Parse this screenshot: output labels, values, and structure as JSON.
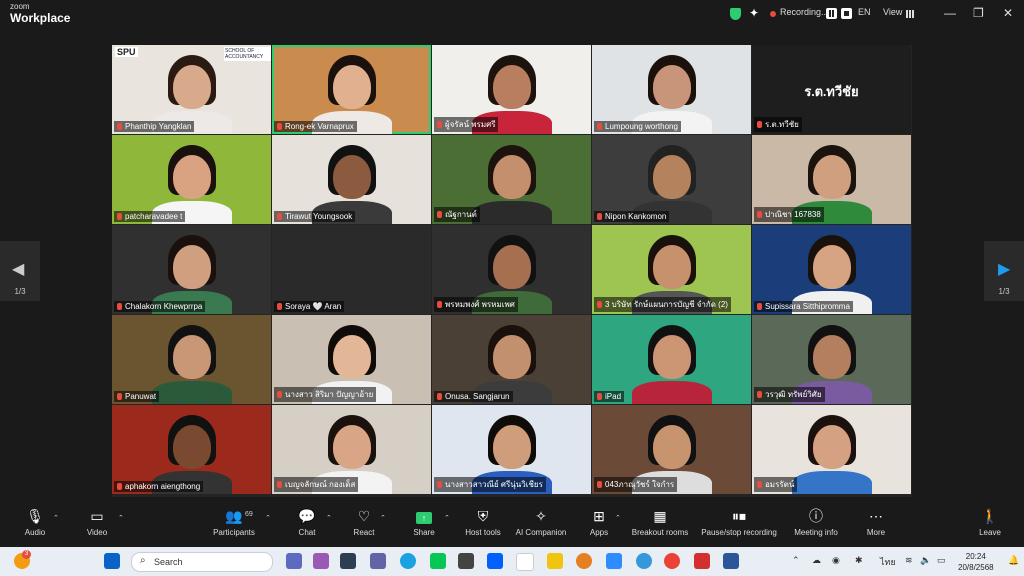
{
  "app": {
    "brand_small": "zoom",
    "brand_large": "Workplace"
  },
  "titlebar": {
    "recording": "Recording...",
    "language": "EN",
    "view": "View"
  },
  "page": {
    "left": "1/3",
    "right": "1/3"
  },
  "participants": [
    {
      "name": "Phanthip Yangklan",
      "logo": "SPU",
      "logo2": "SCHOOL OF ACCOUNTANCY",
      "bg": "#e9e4de",
      "face": "#d8a98a",
      "hair": "#2a1a12",
      "shirt": "#ece9e7"
    },
    {
      "name": "Rong-ek Varnaprux",
      "bg": "#c98b4e",
      "face": "#e0b08f",
      "hair": "#1a110c",
      "shirt": "#efe9e6",
      "active": true
    },
    {
      "name": "ผู้จรัลน์ พรมศรี",
      "bg": "#f0efec",
      "face": "#b97d5f",
      "hair": "#1d130e",
      "shirt": "#c8253a"
    },
    {
      "name": "Lumpoung worthong",
      "bg": "#dfe3e6",
      "face": "#c9957a",
      "hair": "#1a110c",
      "shirt": "#f3f3f3"
    },
    {
      "name": "ร.ต.ทวีชัย",
      "text": "ร.ต.ทวีชัย",
      "bg": "#1e1e1e"
    },
    {
      "name": "patcharavadee t",
      "bg": "#8fb83b",
      "face": "#d9a382",
      "hair": "#1a110c",
      "shirt": "#f5f5f5"
    },
    {
      "name": "Tirawut Youngsook",
      "bg": "#e6e2db",
      "face": "#8c5a3e",
      "hair": "#111",
      "shirt": "#3a3a3a"
    },
    {
      "name": "ณัฐกานต์",
      "bg": "#4a6e34",
      "face": "#c38f6d",
      "hair": "#1d130e",
      "shirt": "#2b2b2b"
    },
    {
      "name": "Nipon Kankomon",
      "bg": "#3d3d3d",
      "face": "#b5825e",
      "hair": "#222",
      "shirt": "#333"
    },
    {
      "name": "ปาณิชา 167838",
      "bg": "#c9b9a6",
      "face": "#cf9f80",
      "hair": "#1d130e",
      "shirt": "#2f8a3c"
    },
    {
      "name": "Chalakorn Khewprrpa",
      "bg": "#303030",
      "face": "#cf9f80",
      "hair": "#1a110c",
      "shirt": "#3a7a50"
    },
    {
      "name": "Soraya 🤍 Aran",
      "bg": "#2a2a2a"
    },
    {
      "name": "พรหมพงศ์ พรหมเพศ",
      "bg": "#2f2f2f",
      "face": "#a66f4f",
      "hair": "#111",
      "shirt": "#3f6a3a"
    },
    {
      "name": "3 บริษัท รักษ์แผนการบัญชี จำกัด (2)",
      "bg": "#9ec451",
      "face": "#c8916e",
      "hair": "#1a110c",
      "shirt": "#555"
    },
    {
      "name": "Supissara Sitthipromma",
      "bg": "#1b3e7a",
      "face": "#d6a383",
      "hair": "#1a110c",
      "shirt": "#f0f0f0"
    },
    {
      "name": "Panuwat",
      "bg": "#6b5530",
      "face": "#c99676",
      "hair": "#111",
      "shirt": "#2b5a3a"
    },
    {
      "name": "นางสาว สิริมา ปัญญาอ้าย",
      "bg": "#c9c0b3",
      "face": "#e2b797",
      "hair": "#0f0b08",
      "shirt": "#f2f2f2"
    },
    {
      "name": "Onusa. Sangjarun",
      "bg": "#4a4036",
      "face": "#c2906e",
      "hair": "#1a110c",
      "shirt": "#3c3c3c"
    },
    {
      "name": "iPad",
      "bg": "#2ea67f",
      "face": "#cc9674",
      "hair": "#111",
      "shirt": "#b8243a"
    },
    {
      "name": "วรวุฒิ ทรัพย์วิศัย",
      "bg": "#5b6a58",
      "face": "#b47f5e",
      "hair": "#111",
      "shirt": "#7a5aa0"
    },
    {
      "name": "aphakorn aiengthong",
      "bg": "#9c2a1c",
      "face": "#7a4a30",
      "hair": "#111",
      "shirt": "#333"
    },
    {
      "name": "เบญจลักษณ์ กองเด็ส",
      "bg": "#d6cfc5",
      "face": "#d8a686",
      "hair": "#1a110c",
      "shirt": "#f3f3f3"
    },
    {
      "name": "นางสาวสาวณีย์ ศรีนุ่นวิเชียร",
      "bg": "#dfe6ef",
      "face": "#cf9c7c",
      "hair": "#0f0b08",
      "shirt": "#2a5fc0"
    },
    {
      "name": "043ภาณุวัชร์ ใจกำร",
      "bg": "#6b4a38",
      "face": "#c7946f",
      "hair": "#111",
      "shirt": "#ddd"
    },
    {
      "name": "อมรรัตน์",
      "bg": "#e8e3dc",
      "face": "#d4a182",
      "hair": "#1a110c",
      "shirt": "#3575c7"
    }
  ],
  "controls": {
    "audio": "Audio",
    "video": "Video",
    "participants": "Participants",
    "participant_count": "69",
    "chat": "Chat",
    "react": "React",
    "share": "Share",
    "host_tools": "Host tools",
    "ai_companion": "AI Companion",
    "apps": "Apps",
    "breakout_rooms": "Breakout rooms",
    "pause_stop": "Pause/stop recording",
    "meeting_info": "Meeting info",
    "more": "More",
    "leave": "Leave"
  },
  "taskbar": {
    "search": "Search",
    "notification_count": "3",
    "tray_lang": "ไทย",
    "time": "20:24",
    "date": "20/8/2568"
  }
}
